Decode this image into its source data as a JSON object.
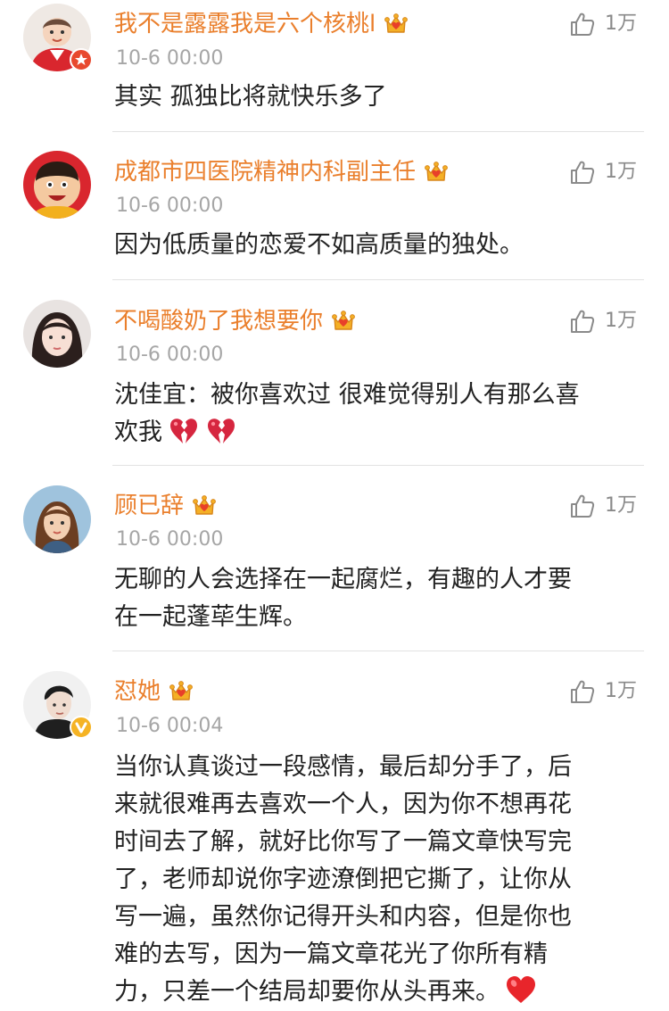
{
  "colors": {
    "username": "#ea7f2c",
    "timestamp": "#a6a6a6",
    "body_text": "#222222",
    "divider": "#e2e2e2",
    "badge_red": "#e8492e",
    "badge_gold": "#f5b324",
    "heart_red": "#e8252b"
  },
  "comments": [
    {
      "username": "我不是露露我是六个核桃l",
      "vip_icon": "crown-vip-icon",
      "timestamp": "10-6 00:00",
      "likes": "1万",
      "badge": "red-star-badge",
      "lines": [
        "其实 孤独比将就快乐多了"
      ]
    },
    {
      "username": "成都市四医院精神内科副主任",
      "vip_icon": "crown-vip-icon",
      "timestamp": "10-6 00:00",
      "likes": "1万",
      "lines": [
        "因为低质量的恋爱不如高质量的独处。"
      ]
    },
    {
      "username": "不喝酸奶了我想要你",
      "vip_icon": "crown-vip-icon",
      "timestamp": "10-6 00:00",
      "likes": "1万",
      "lines": [
        "沈佳宜：被你喜欢过 很难觉得别人有那么喜",
        "欢我"
      ],
      "emojis": [
        "broken-heart-emoji",
        "broken-heart-emoji"
      ]
    },
    {
      "username": "顾已辞",
      "vip_icon": "crown-vip-icon",
      "timestamp": "10-6 00:00",
      "likes": "1万",
      "lines": [
        "无聊的人会选择在一起腐烂，有趣的人才要",
        "在一起蓬荜生辉。"
      ]
    },
    {
      "username": "怼她",
      "vip_icon": "crown-vip-icon",
      "timestamp": "10-6 00:04",
      "likes": "1万",
      "badge": "verified-v-badge",
      "lines": [
        "当你认真谈过一段感情，最后却分手了，后",
        "来就很难再去喜欢一个人，因为你不想再花",
        "时间去了解，就好比你写了一篇文章快写完",
        "了，老师却说你字迹潦倒把它撕了，让你从",
        "写一遍，虽然你记得开头和内容，但是你也",
        "难的去写，因为一篇文章花光了你所有精",
        "力，只差一个结局却要你从头再来。"
      ],
      "emojis": [
        "red-heart-emoji"
      ]
    }
  ]
}
